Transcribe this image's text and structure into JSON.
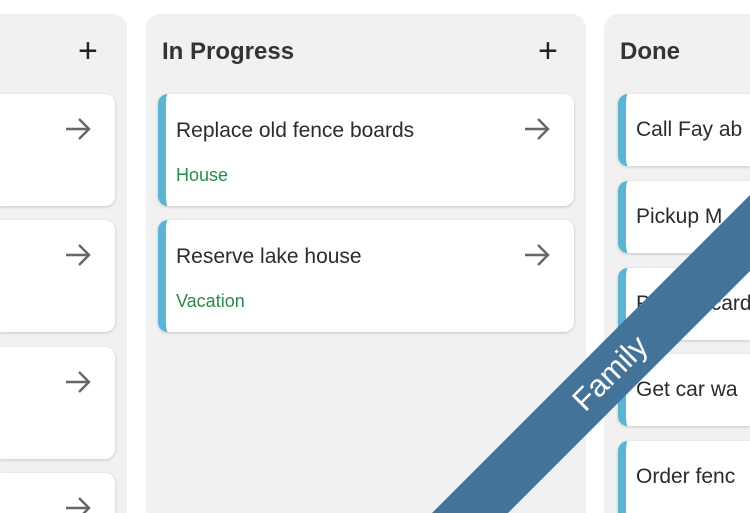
{
  "columns": [
    {
      "title": "",
      "cards": [
        {
          "title": "",
          "tag": ""
        },
        {
          "title": "",
          "tag": ""
        },
        {
          "title": "",
          "tag": ""
        },
        {
          "title": "",
          "tag": ""
        }
      ]
    },
    {
      "title": "In Progress",
      "cards": [
        {
          "title": "Replace old fence boards",
          "tag": "House"
        },
        {
          "title": "Reserve lake house",
          "tag": "Vacation"
        }
      ]
    },
    {
      "title": "Done",
      "cards": [
        {
          "title": "Call Fay ab"
        },
        {
          "title": "Pickup M"
        },
        {
          "title": "Pick up card"
        },
        {
          "title": "Get car wa"
        },
        {
          "title": "Order fenc"
        }
      ]
    }
  ],
  "ribbon": {
    "label": "Family",
    "color": "#44739a"
  },
  "colors": {
    "accent": "#5bb4d4",
    "tag": "#2a8a47"
  },
  "icons": {
    "add": "plus-icon",
    "move": "arrow-right-icon"
  }
}
